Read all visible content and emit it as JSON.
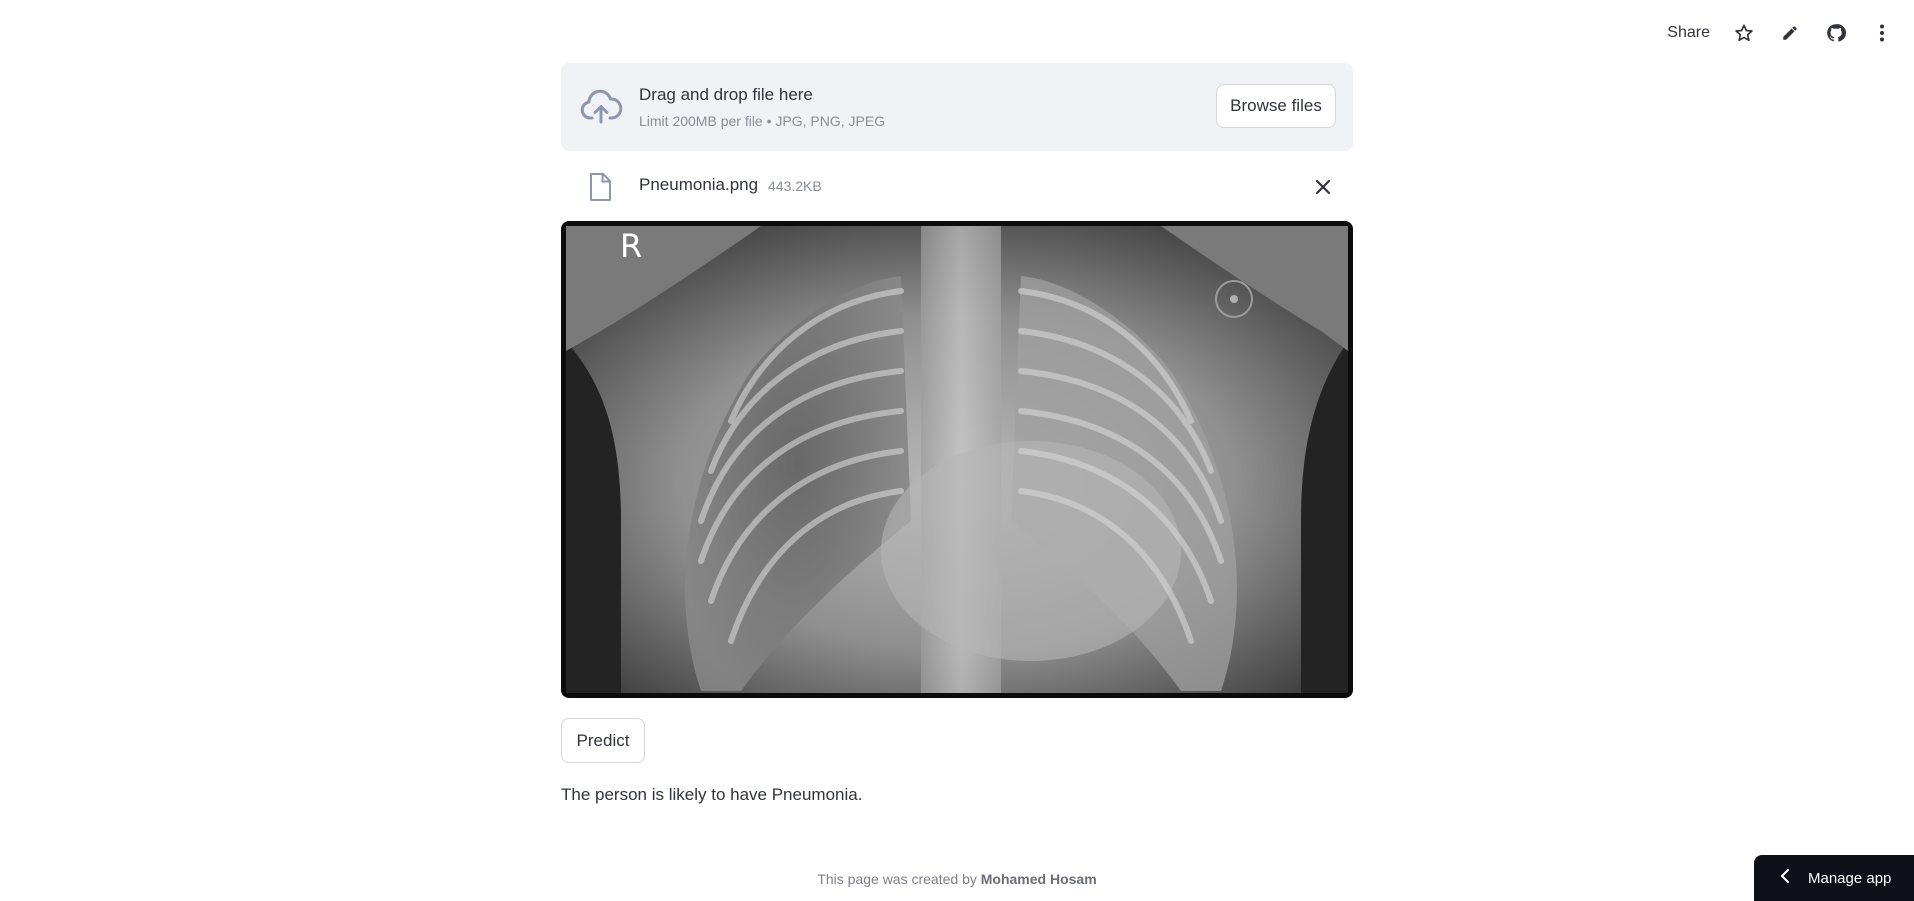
{
  "toolbar": {
    "share_label": "Share",
    "icons": [
      "star-icon",
      "pencil-icon",
      "github-icon",
      "kebab-menu-icon"
    ]
  },
  "uploader": {
    "title": "Drag and drop file here",
    "subtitle": "Limit 200MB per file • JPG, PNG, JPEG",
    "browse_label": "Browse files",
    "icon": "cloud-upload-icon"
  },
  "file": {
    "name": "Pneumonia.png",
    "size": "443.2KB",
    "icon": "file-icon",
    "remove_icon": "close-icon"
  },
  "image": {
    "marker": "R"
  },
  "predict_label": "Predict",
  "result_text": "The person is likely to have Pneumonia.",
  "footer": {
    "prefix": "This page was created by",
    "author": "Mohamed Hosam"
  },
  "manage_app_label": "Manage app",
  "colors": {
    "accent_text": "#31333f",
    "muted_text": "#8a8d97",
    "dropzone_bg": "#f0f2f6",
    "manage_bg": "#0e1117"
  }
}
